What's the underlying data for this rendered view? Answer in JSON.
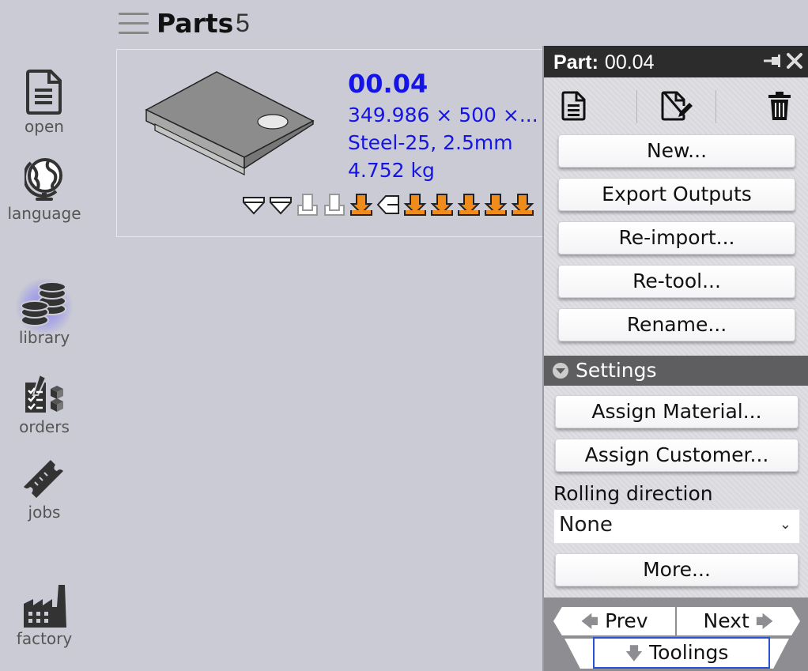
{
  "nav": {
    "items": [
      {
        "label": "open",
        "icon": "document-icon"
      },
      {
        "label": "language",
        "icon": "globe-icon"
      },
      {
        "label": "library",
        "icon": "coin-stack-icon",
        "active": true
      },
      {
        "label": "orders",
        "icon": "orders-icon"
      },
      {
        "label": "jobs",
        "icon": "ticket-icon"
      },
      {
        "label": "factory",
        "icon": "factory-icon"
      }
    ],
    "active_glow_color": "#6a60ff"
  },
  "header": {
    "title": "Parts",
    "count": "5"
  },
  "part_card": {
    "name": "00.04",
    "dimensions": "349.986 × 500 ×...",
    "material": "Steel-25, 2.5mm",
    "weight": "4.752 kg",
    "operation_icons": [
      "bend-down-outline",
      "bend-down-outline",
      "bend-up-disabled",
      "bend-up-disabled",
      "bend-orange",
      "tab-outline",
      "bend-orange",
      "bend-orange",
      "bend-orange",
      "bend-orange",
      "bend-orange"
    ],
    "accent_color": "#1414e8",
    "operation_color": "#f08c1c"
  },
  "panel": {
    "header_label": "Part:",
    "header_value": "00.04",
    "toolbar_icons": [
      "document-icon",
      "edit-document-icon",
      "trash-icon"
    ],
    "buttons": {
      "new": "New...",
      "export": "Export Outputs",
      "reimport": "Re-import...",
      "retool": "Re-tool...",
      "rename": "Rename..."
    },
    "settings": {
      "title": "Settings",
      "assign_material": "Assign Material...",
      "assign_customer": "Assign Customer...",
      "rolling_label": "Rolling direction",
      "rolling_value": "None",
      "more": "More..."
    },
    "footer": {
      "prev": "Prev",
      "next": "Next",
      "toolings": "Toolings"
    }
  }
}
